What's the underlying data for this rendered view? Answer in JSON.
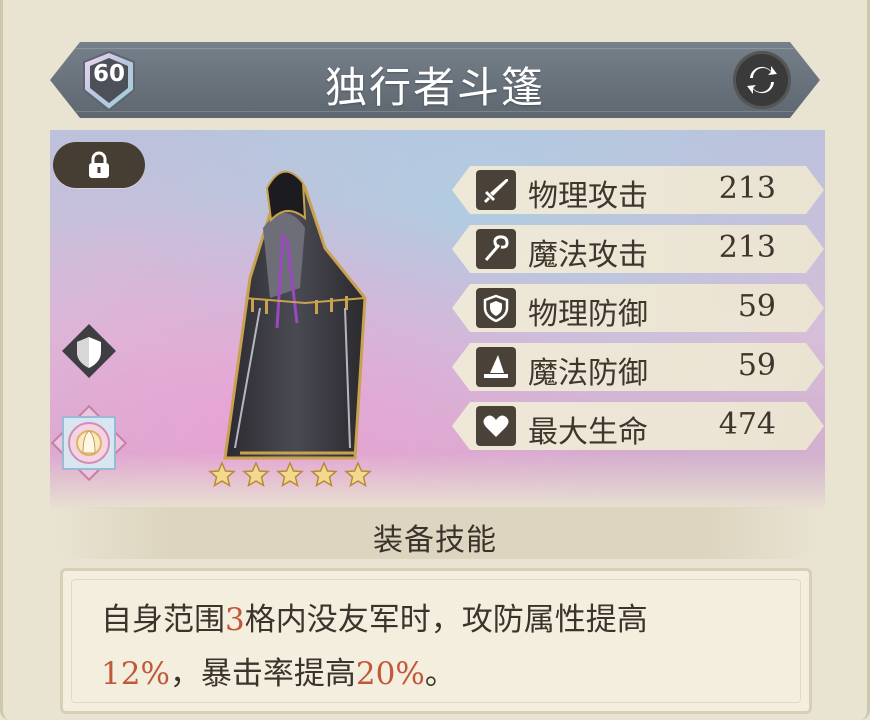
{
  "header": {
    "level": "60",
    "title": "独行者斗篷"
  },
  "stats": [
    {
      "icon": "sword-icon",
      "label": "物理攻击",
      "value": "213"
    },
    {
      "icon": "wand-icon",
      "label": "魔法攻击",
      "value": "213"
    },
    {
      "icon": "shield-icon",
      "label": "物理防御",
      "value": "59"
    },
    {
      "icon": "wizard-hat-icon",
      "label": "魔法防御",
      "value": "59"
    },
    {
      "icon": "heart-icon",
      "label": "最大生命",
      "value": "474"
    }
  ],
  "rarity_stars": 5,
  "skill": {
    "title": "装备技能",
    "desc": {
      "p1": "自身范围",
      "n1": "3",
      "p2": "格内没友军时，攻防属性提高",
      "n2": "12%",
      "p3": "，暴击率提高",
      "n3": "20%",
      "p4": "。"
    }
  },
  "colors": {
    "highlight": "#c0593a",
    "header_bg": "#6b747d",
    "text": "#3e352c"
  }
}
